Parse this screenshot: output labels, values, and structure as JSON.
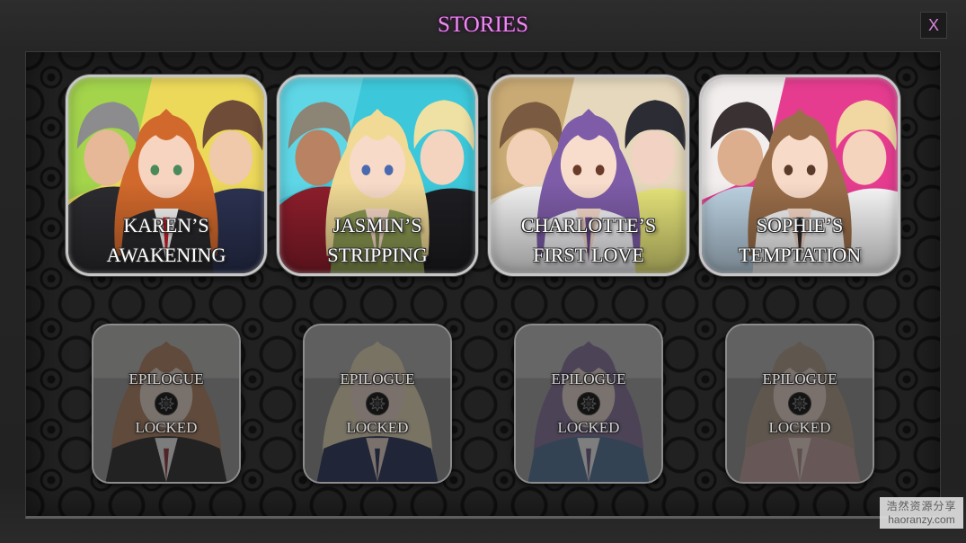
{
  "theme": {
    "title": "#e98fee",
    "close": "#d685dc"
  },
  "header": {
    "title": "STORIES",
    "close_label": "X"
  },
  "stories": [
    {
      "line1": "KAREN’S",
      "line2": "AWAKENING",
      "palette": {
        "bg1": "#ecd95a",
        "bg2": "#a3d44c",
        "lhair": "#8c8c8e",
        "lface": "#e6b898",
        "lbody": "#2c2c30",
        "rhair": "#6e4c38",
        "rface": "#f0c8aa",
        "rbody": "#2c3252",
        "chair": "#d2692c",
        "cface": "#f7d4c0",
        "cbody": "#2a2a2e",
        "cshirt": "#f5f5f5",
        "ctie": "#c9202c",
        "eye": "#4a8a5a"
      }
    },
    {
      "line1": "JASMIN’S",
      "line2": "STRIPPING",
      "palette": {
        "bg1": "#3cc8da",
        "bg2": "#5ed6e6",
        "lhair": "#8c8474",
        "lface": "#b98262",
        "lbody": "#8e1e2c",
        "rhair": "#efe0a4",
        "rface": "#f4d4be",
        "rbody": "#1e1e22",
        "chair": "#f1da96",
        "cface": "#f8dac8",
        "cbody": "#8c9a52",
        "cshirt": "#f8dac8",
        "ctie": "#7a8a46",
        "eye": "#4a6ab0"
      }
    },
    {
      "line1": "CHARLOTTE’S",
      "line2": "FIRST LOVE",
      "palette": {
        "bg1": "#e6d8bc",
        "bg2": "#c9aa74",
        "lhair": "#7a5a40",
        "lface": "#f2d0b8",
        "lbody": "#f2f2f2",
        "rhair": "#2c2c34",
        "rface": "#f2d2c2",
        "rbody": "#e6e47a",
        "chair": "#7e5ca8",
        "cface": "#f8dccc",
        "cbody": "#f4f4f8",
        "cshirt": "#f8dccc",
        "ctie": "#6a4a92",
        "eye": "#6a3a2a"
      }
    },
    {
      "line1": "SOPHIE’S",
      "line2": "TEMPTATION",
      "palette": {
        "bg1": "#e63c90",
        "bg2": "#f2eeee",
        "lhair": "#3a3232",
        "lface": "#dcae8e",
        "lbody": "#bcd2e2",
        "rhair": "#f1d8a2",
        "rface": "#f4d4bc",
        "rbody": "#f8f8f8",
        "chair": "#9a6e4a",
        "cface": "#f8dac8",
        "cbody": "#f6f6f6",
        "cshirt": "#f8dac8",
        "ctie": "#2a2a30",
        "eye": "#5a3a2a"
      }
    }
  ],
  "epilogues": [
    {
      "line1": "EPILOGUE",
      "line2": "LOCKED",
      "icon": "lock-icon",
      "palette": {
        "bg": "#9a9a98",
        "bg2": "#b8b8b4",
        "hair": "#c97a48",
        "body": "#26262a",
        "shirt": "#f0f0f0",
        "accent": "#c0202c",
        "face": "#f4d4c0"
      }
    },
    {
      "line1": "EPILOGUE",
      "line2": "LOCKED",
      "icon": "lock-icon",
      "palette": {
        "bg": "#8a8a8a",
        "bg2": "#b0b0b0",
        "hair": "#f0dca2",
        "body": "#1c2c70",
        "shirt": "#f6d6c4",
        "accent": "#1c2c70",
        "face": "#f6d6c4"
      }
    },
    {
      "line1": "EPILOGUE",
      "line2": "LOCKED",
      "icon": "lock-icon",
      "palette": {
        "bg": "#a0a0a0",
        "bg2": "#c0c0c0",
        "hair": "#8c6cb4",
        "body": "#3c74b4",
        "shirt": "#f4f4f4",
        "accent": "#7050a0",
        "face": "#f6d8c8"
      }
    },
    {
      "line1": "EPILOGUE",
      "line2": "LOCKED",
      "icon": "lock-icon",
      "palette": {
        "bg": "#909090",
        "bg2": "#b4b4b4",
        "hair": "#b89a7a",
        "body": "#d49a98",
        "shirt": "#f6d6c6",
        "accent": "#c08a88",
        "face": "#f6d6c6"
      }
    }
  ],
  "watermark": {
    "line1": "浩然资源分享",
    "line2": "haoranzy.com"
  }
}
